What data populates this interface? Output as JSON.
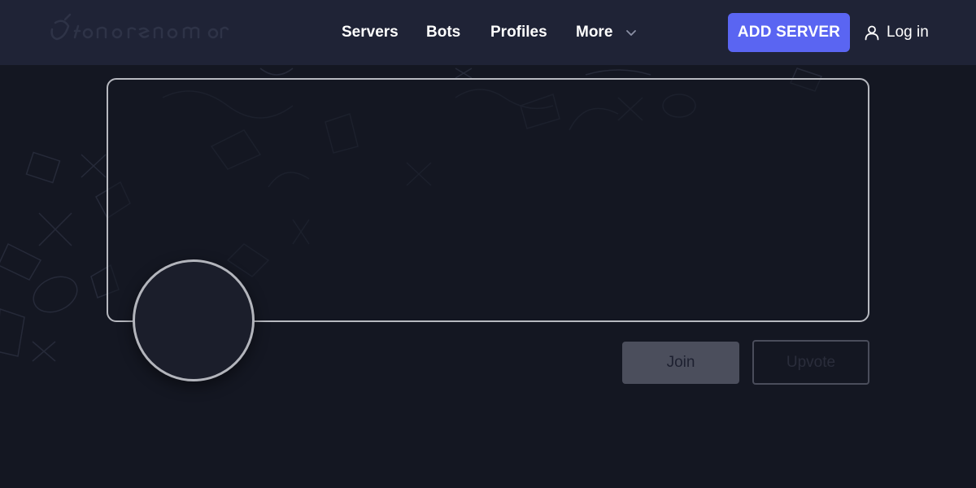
{
  "nav": {
    "logo_icon": "site-logo-icon",
    "links": [
      {
        "label": "Servers"
      },
      {
        "label": "Bots"
      },
      {
        "label": "Profiles"
      },
      {
        "label": "More"
      }
    ],
    "more_icon": "chevron-down-icon",
    "add_server_label": "ADD SERVER",
    "login_label": "Log in",
    "login_icon": "user-icon"
  },
  "server": {
    "join_label": "Join",
    "upvote_label": "Upvote"
  },
  "colors": {
    "navbar_bg": "#1f2336",
    "page_bg": "#141722",
    "accent": "#5a65f2",
    "banner_border": "#b7b9c0",
    "join_bg": "#4b4e5c"
  }
}
